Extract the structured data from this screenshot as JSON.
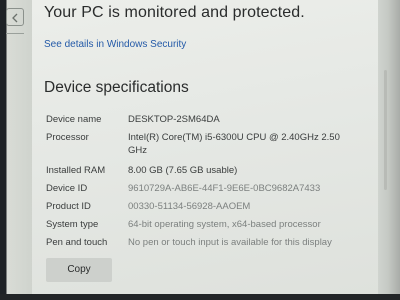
{
  "protection": {
    "status_title": "Your PC is monitored and protected.",
    "security_link": "See details in Windows Security"
  },
  "specs": {
    "heading": "Device specifications",
    "rows": [
      {
        "label": "Device name",
        "value": "DESKTOP-2SM64DA"
      },
      {
        "label": "Processor",
        "value": "Intel(R) Core(TM) i5-6300U CPU @ 2.40GHz   2.50 GHz"
      },
      {
        "label": "Installed RAM",
        "value": "8.00 GB (7.65 GB usable)"
      },
      {
        "label": "Device ID",
        "value": "9610729A-AB6E-44F1-9E6E-0BC9682A7433"
      },
      {
        "label": "Product ID",
        "value": "00330-51134-56928-AAOEM"
      },
      {
        "label": "System type",
        "value": "64-bit operating system, x64-based processor"
      },
      {
        "label": "Pen and touch",
        "value": "No pen or touch input is available for this display"
      }
    ],
    "copy_label": "Copy"
  },
  "icons": {
    "back": "back-arrow-icon"
  },
  "colors": {
    "link": "#245aa8",
    "panel_background": "#e8eae6",
    "text": "#2a2c2c"
  }
}
